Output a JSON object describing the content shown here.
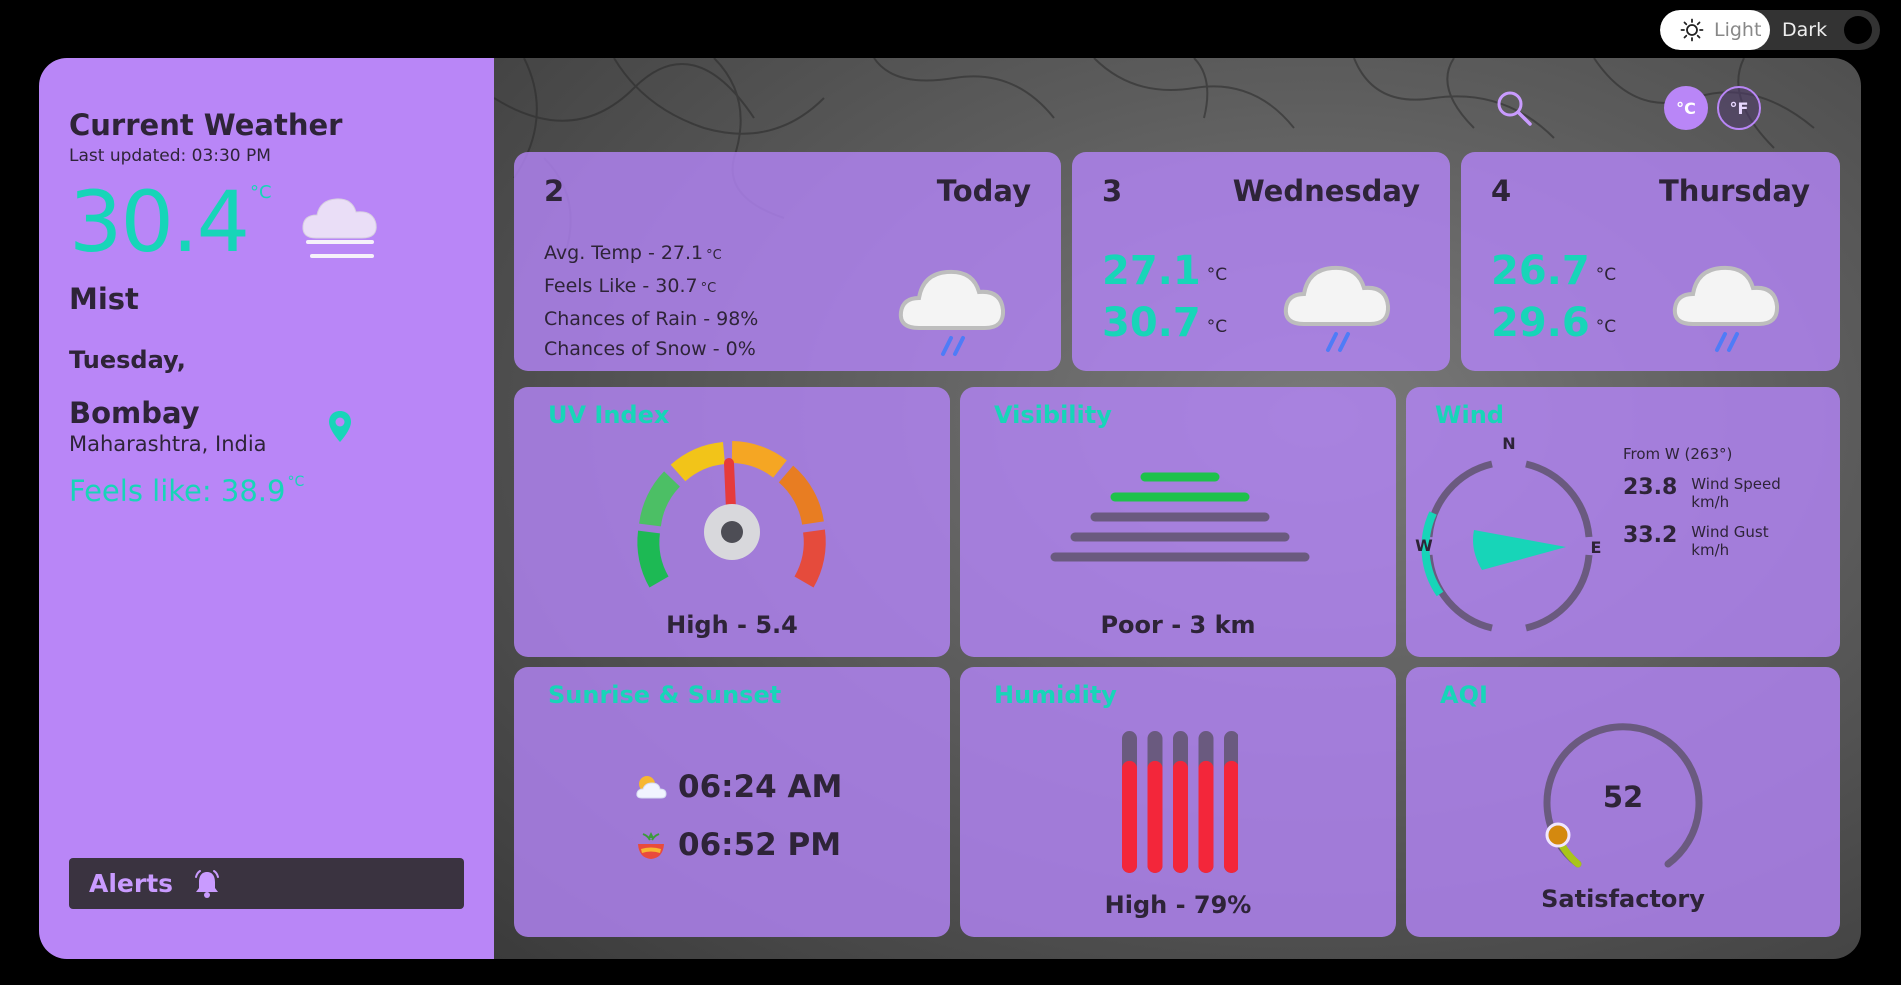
{
  "theme": {
    "light_label": "Light",
    "dark_label": "Dark"
  },
  "current": {
    "title": "Current Weather",
    "last_updated": "Last updated: 03:30 PM",
    "temp": "30.4",
    "unit": "°C",
    "condition": "Mist",
    "day": "Tuesday,",
    "city": "Bombay",
    "region": "Maharashtra, India",
    "feels_like": "Feels like: 38.9",
    "feels_unit": "°C"
  },
  "alerts": {
    "label": "Alerts"
  },
  "units": {
    "celsius": "°C",
    "fahrenheit": "°F"
  },
  "forecast": [
    {
      "num": "2",
      "day": "Today",
      "avg_temp": "Avg. Temp - 27.1",
      "feels_like": "Feels Like - 30.7",
      "unit": "°C",
      "rain": "Chances of Rain - 98%",
      "snow": "Chances of Snow - 0%"
    },
    {
      "num": "3",
      "day": "Wednesday",
      "min": "27.1",
      "max": "30.7",
      "unit": "°C"
    },
    {
      "num": "4",
      "day": "Thursday",
      "min": "26.7",
      "max": "29.6",
      "unit": "°C"
    }
  ],
  "uv": {
    "title": "UV Index",
    "value": "High - 5.4"
  },
  "visibility": {
    "title": "Visibility",
    "value": "Poor - 3 km"
  },
  "wind": {
    "title": "Wind",
    "compass": {
      "n": "N",
      "e": "E",
      "w": "W"
    },
    "from": "From W (263°)",
    "speed": "23.8",
    "speed_label": "Wind Speed",
    "speed_unit": "km/h",
    "gust": "33.2",
    "gust_label": "Wind Gust",
    "gust_unit": "km/h"
  },
  "sun": {
    "title": "Sunrise & Sunset",
    "sunrise": "06:24 AM",
    "sunset": "06:52 PM"
  },
  "humidity": {
    "title": "Humidity",
    "value": "High - 79%",
    "level": 79
  },
  "aqi": {
    "title": "AQI",
    "number": "52",
    "label": "Satisfactory"
  },
  "colors": {
    "accent": "#17d5b8",
    "panel": "#b986f7",
    "text": "#2e2438"
  }
}
